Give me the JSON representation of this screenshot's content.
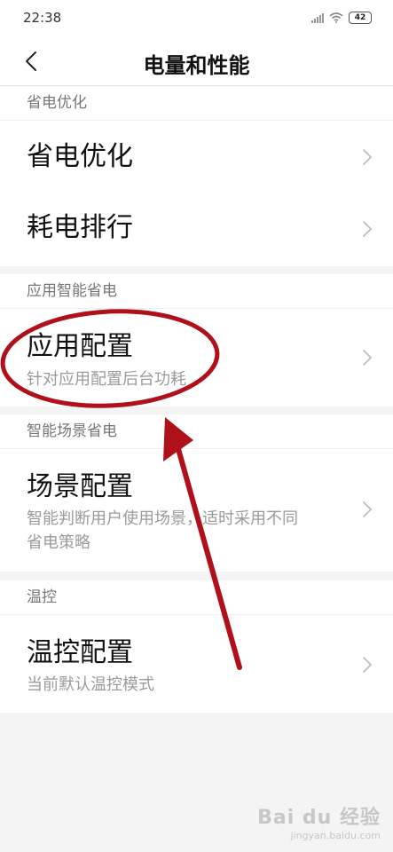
{
  "status": {
    "time": "22:38",
    "battery": "42"
  },
  "header": {
    "title": "电量和性能"
  },
  "sections": [
    {
      "header": "省电优化",
      "rows": [
        {
          "title": "省电优化"
        },
        {
          "title": "耗电排行"
        }
      ]
    },
    {
      "header": "应用智能省电",
      "rows": [
        {
          "title": "应用配置",
          "subtitle": "针对应用配置后台功耗"
        }
      ]
    },
    {
      "header": "智能场景省电",
      "rows": [
        {
          "title": "场景配置",
          "subtitle_line1": "智能判断用户使用场景，适时采用不同",
          "subtitle_line2": "省电策略"
        }
      ]
    },
    {
      "header": "温控",
      "rows": [
        {
          "title": "温控配置",
          "subtitle": "当前默认温控模式"
        }
      ]
    }
  ],
  "watermark": {
    "brand": "Bai du 经验",
    "url": "jingyan.baidu.com"
  },
  "colors": {
    "annotation": "#b0101a",
    "chevron": "#bdbdbd"
  }
}
